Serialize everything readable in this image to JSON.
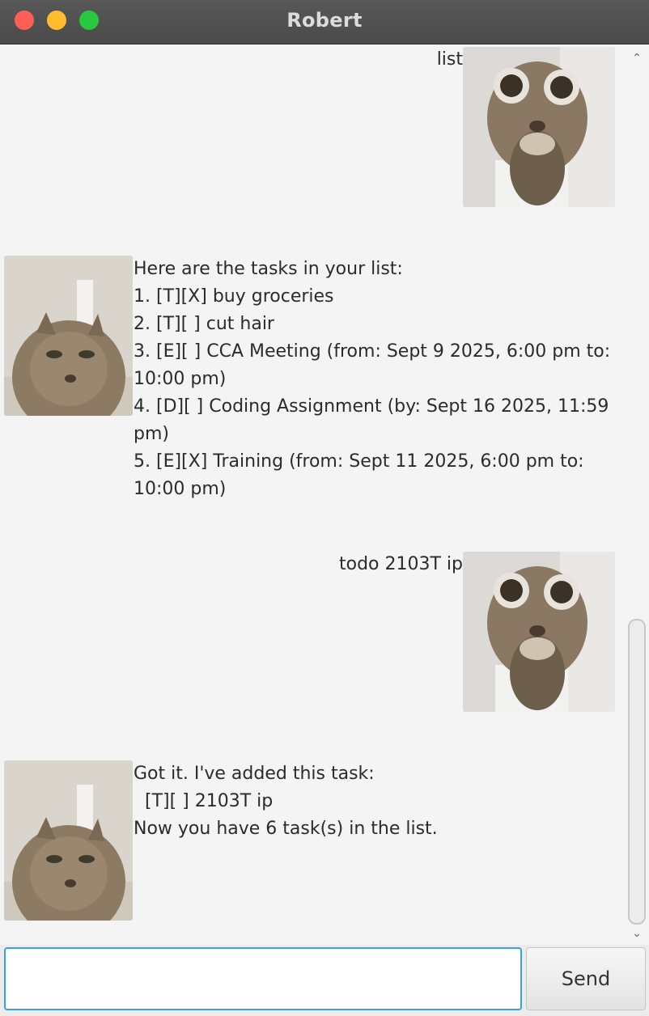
{
  "window": {
    "title": "Robert"
  },
  "dialog": [
    {
      "speaker": "user",
      "text": "list"
    },
    {
      "speaker": "bot",
      "text": "Here are the tasks in your list:\n1. [T][X] buy groceries\n2. [T][ ] cut hair\n3. [E][ ] CCA Meeting (from: Sept 9 2025, 6:00 pm to:\n10:00 pm)\n4. [D][ ] Coding Assignment (by: Sept 16 2025, 11:59\npm)\n5. [E][X] Training (from: Sept 11 2025, 6:00 pm to:\n10:00 pm)"
    },
    {
      "speaker": "user",
      "text": "todo 2103T ip"
    },
    {
      "speaker": "bot",
      "text": "Got it. I've added this task:\n  [T][ ] 2103T ip\nNow you have 6 task(s) in the list."
    }
  ],
  "input": {
    "value": "",
    "placeholder": ""
  },
  "send_button": {
    "label": "Send"
  },
  "colors": {
    "focus_ring": "#3aa0e0",
    "titlebar": "#4f4f4f",
    "background": "#f4f4f4"
  }
}
